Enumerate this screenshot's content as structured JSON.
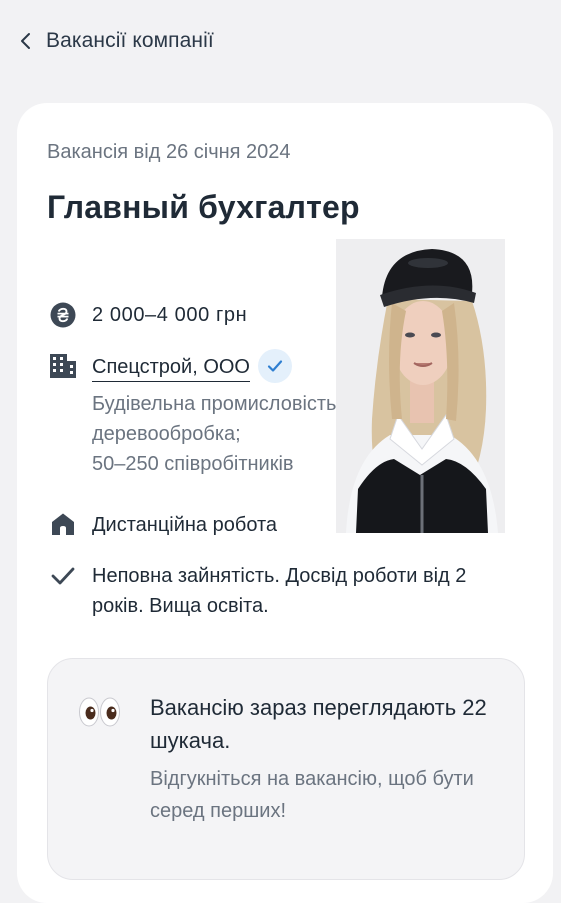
{
  "header": {
    "back_label": "Вакансії компанії"
  },
  "vacancy": {
    "posted": "Вакансія від 26 січня 2024",
    "title": "Главный бухгалтер",
    "salary": "2 000–4 000 грн",
    "company_name": "Спецстрой, ООО",
    "company_details": [
      "Будівельна промисловість,",
      "деревообробка;",
      "50–250 співробітників"
    ],
    "work_format": "Дистанційна робота",
    "terms": "Неповна зайнятість. Досвід роботи від 2 років. Вища освіта."
  },
  "viewers": {
    "title": "Вакансію зараз переглядають 22 шукача.",
    "subtitle": "Відгукніться на вакансію, щоб бути серед перших!"
  },
  "icons": {
    "back": "chevron-left-icon",
    "salary": "hryvnia-coin-icon",
    "company": "building-icon",
    "verified": "checkmark-icon",
    "remote": "home-icon",
    "terms": "checkmark-icon",
    "viewers": "eyes-emoji-icon"
  },
  "colors": {
    "page_background": "#f2f2f4",
    "card_background": "#ffffff",
    "primary_text": "#1f2a36",
    "secondary_text": "#6b7480",
    "verified_badge": "#e4f0fb",
    "verified_check": "#2f7fd1"
  }
}
